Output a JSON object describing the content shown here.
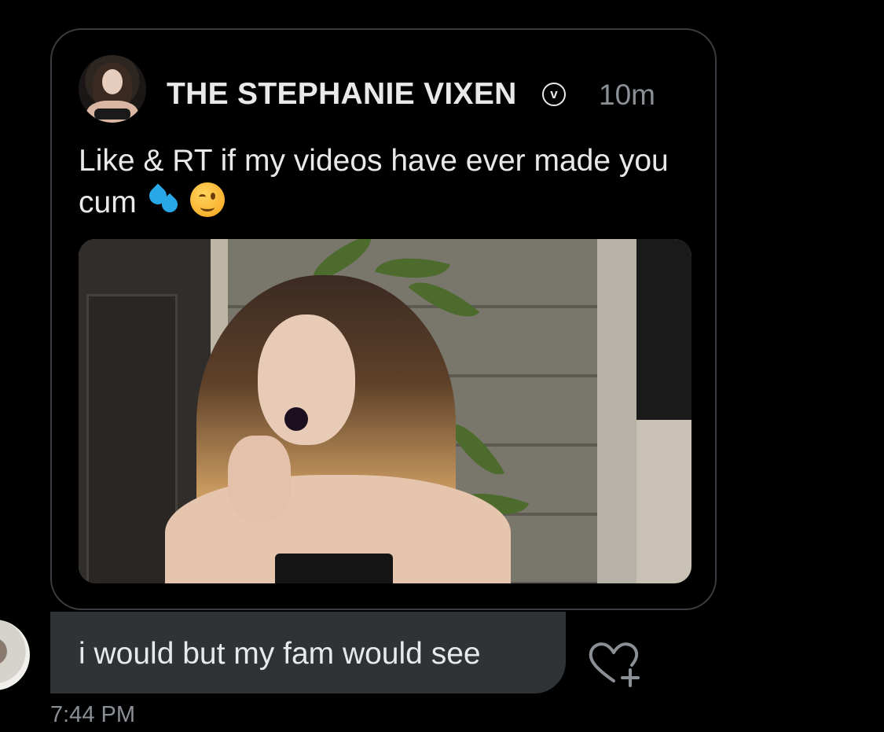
{
  "tweet": {
    "author_name": "THE STEPHANIE VIXEN",
    "verified_glyph": "v",
    "relative_time": "10m",
    "text": "Like & RT if my videos have ever made you cum",
    "emojis": [
      "sweat-droplets-emoji",
      "winking-face-emoji"
    ],
    "has_media": true
  },
  "message": {
    "text": "i would but my fam would see",
    "sent_time": "7:44 PM"
  },
  "icons": {
    "react": "heart-plus-icon",
    "verified": "verified-badge-icon"
  },
  "colors": {
    "background": "#000000",
    "card_border": "#3a3d41",
    "bubble": "#2f3336",
    "text_primary": "#e7e9ea",
    "text_secondary": "#8b9096"
  }
}
